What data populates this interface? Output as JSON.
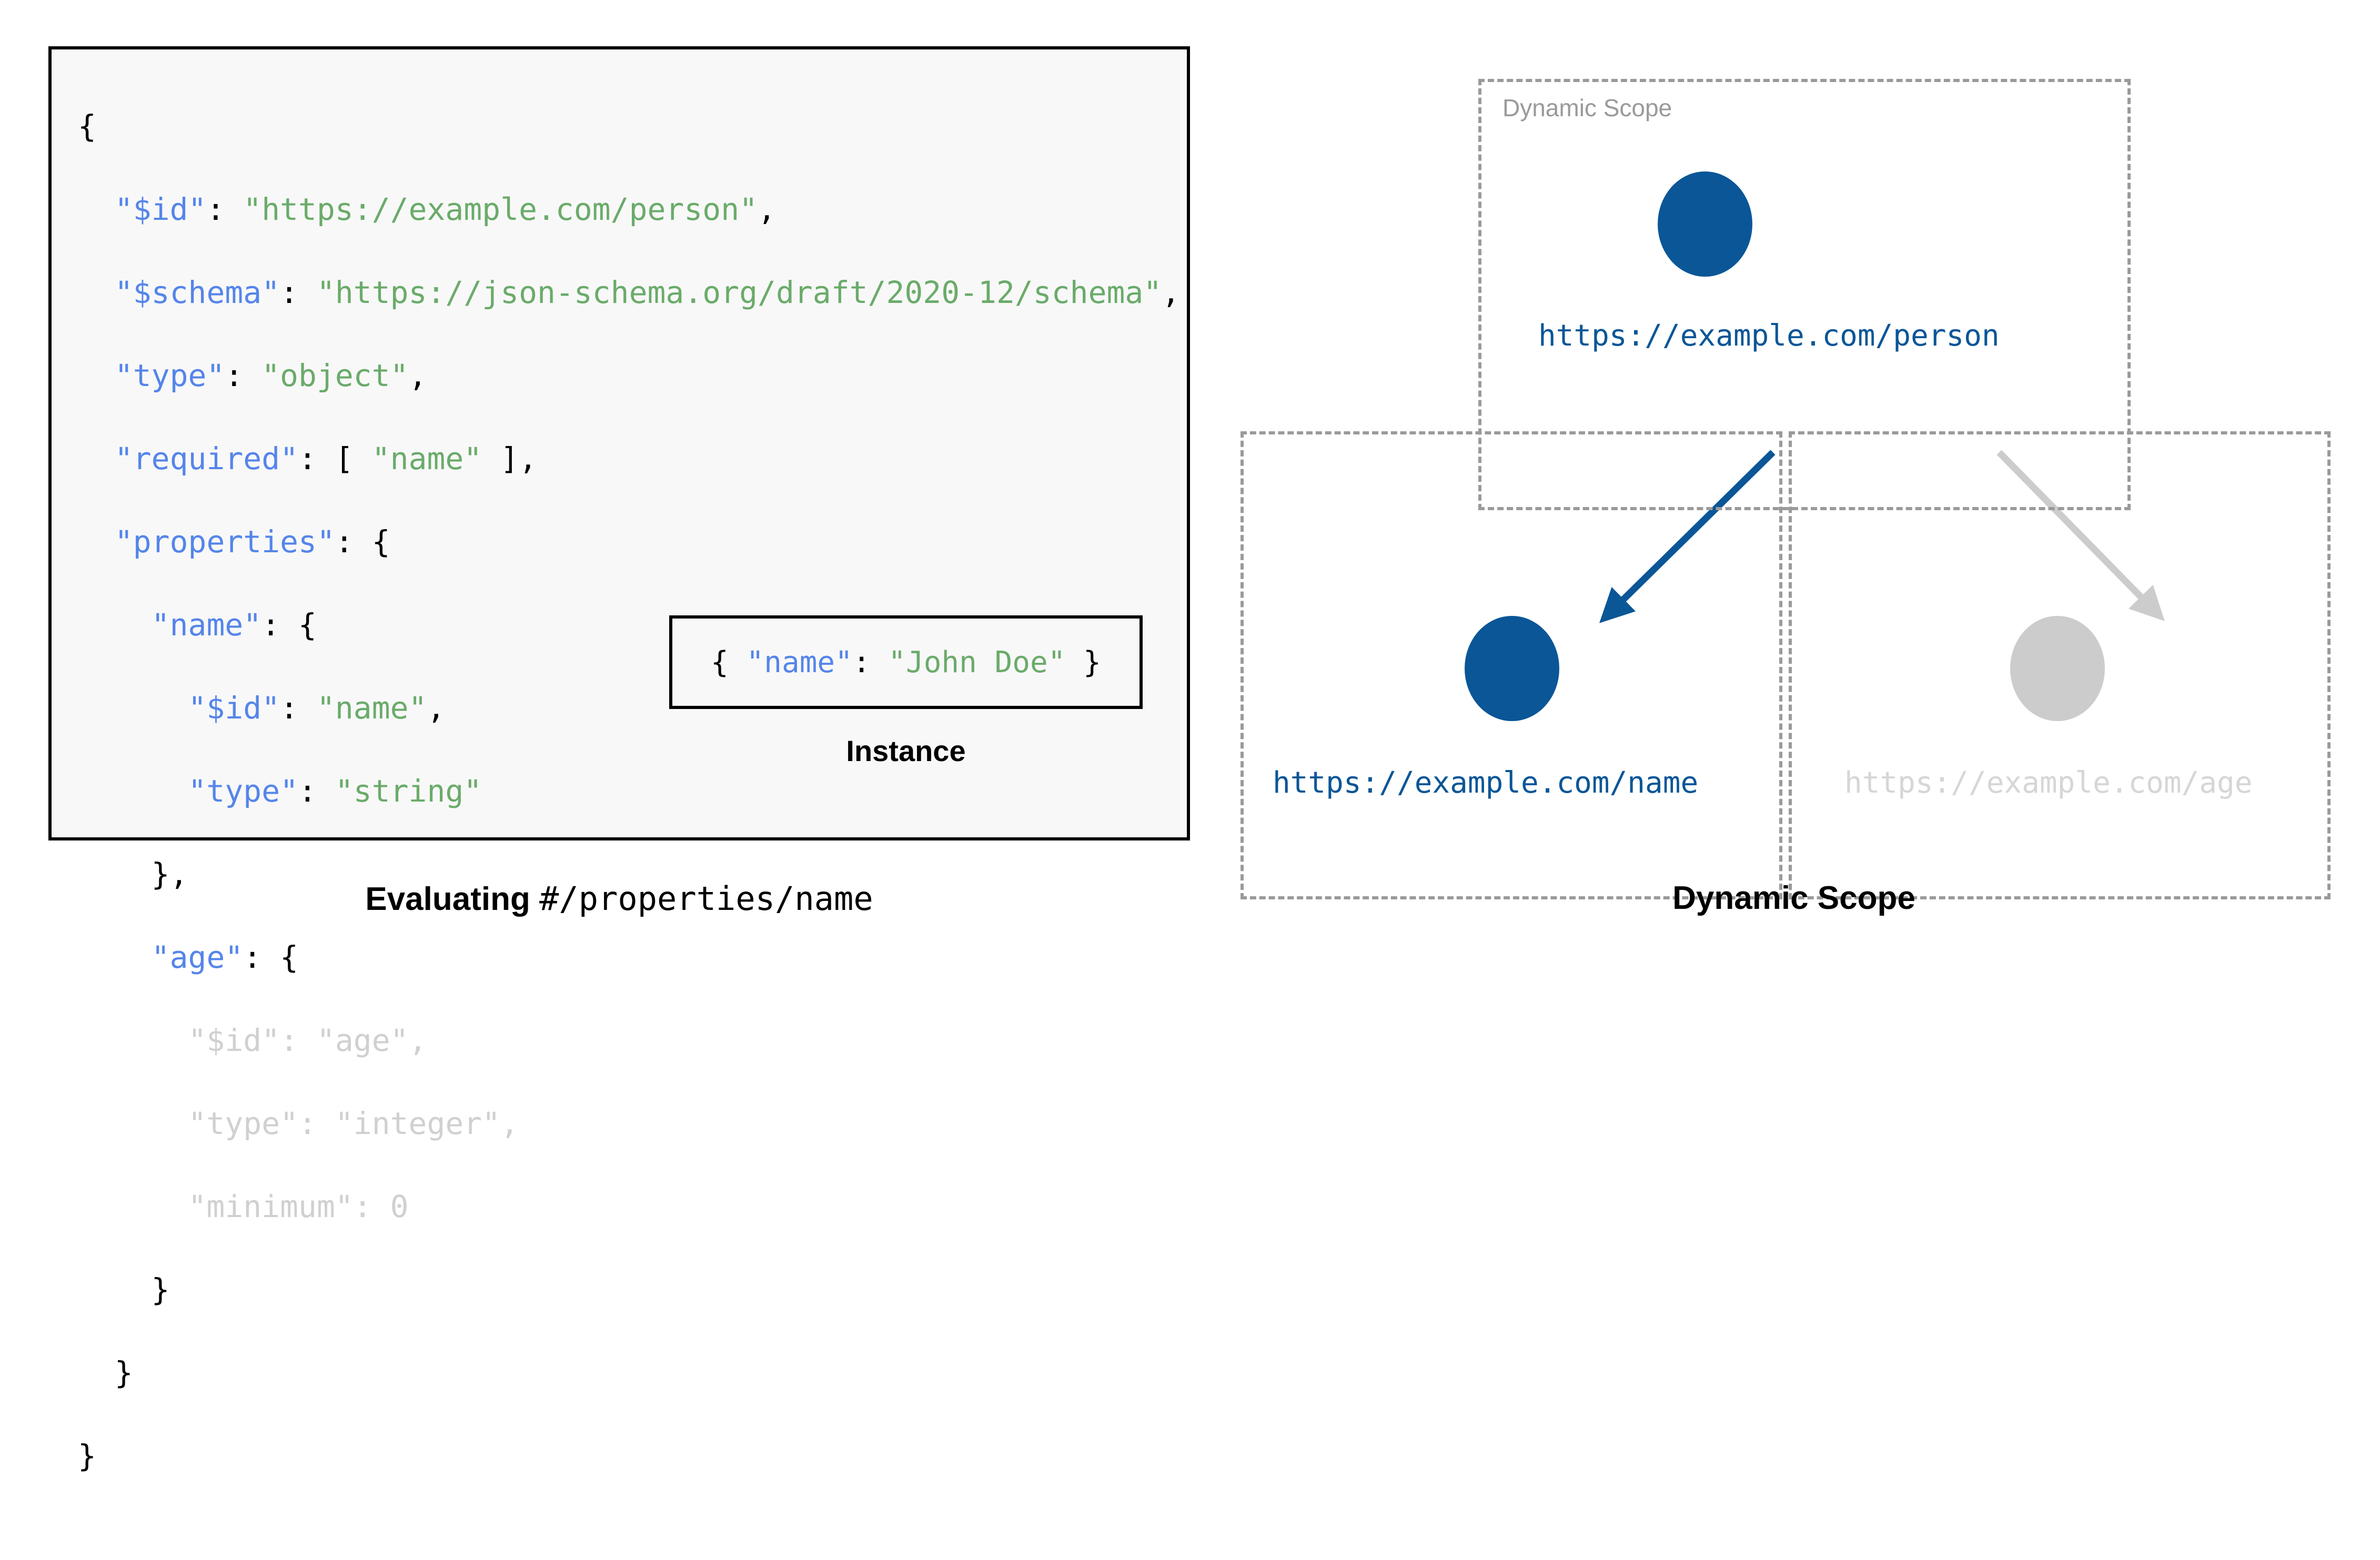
{
  "left": {
    "panel_background": "#f8f8f8",
    "border_color": "#000000",
    "syntax_colors": {
      "key": "#5585ea",
      "string": "#6aab6a",
      "punctuation": "#000000",
      "dimmed": "#d0d0d0"
    },
    "code_lines": [
      "{",
      "  \"$id\": \"https://example.com/person\",",
      "  \"$schema\": \"https://json-schema.org/draft/2020-12/schema\",",
      "  \"type\": \"object\",",
      "  \"required\": [ \"name\" ],",
      "  \"properties\": {",
      "    \"name\": {",
      "      \"$id\": \"name\",",
      "      \"type\": \"string\"",
      "    },",
      "    \"age\": {",
      "      \"$id\": \"age\",",
      "      \"type\": \"integer\",",
      "      \"minimum\": 0",
      "    }",
      "  }",
      "}"
    ],
    "instance": {
      "code": "{ \"name\": \"John Doe\" }",
      "key": "name",
      "value": "John Doe",
      "caption": "Instance"
    },
    "caption": {
      "bold_part": "Evaluating ",
      "mono_part": "#/properties/name"
    }
  },
  "right": {
    "caption": "Dynamic Scope",
    "scope_label": "Dynamic Scope",
    "colors": {
      "active_blue": "#0a5697",
      "inactive_grey": "#cccccc",
      "inactive_label_grey": "#d6d6d6",
      "dash_grey": "#9a9a9a"
    },
    "nodes": [
      {
        "id": "root",
        "label": "https://example.com/person",
        "state": "active"
      },
      {
        "id": "name",
        "label": "https://example.com/name",
        "state": "active"
      },
      {
        "id": "age",
        "label": "https://example.com/age",
        "state": "inactive"
      }
    ]
  }
}
